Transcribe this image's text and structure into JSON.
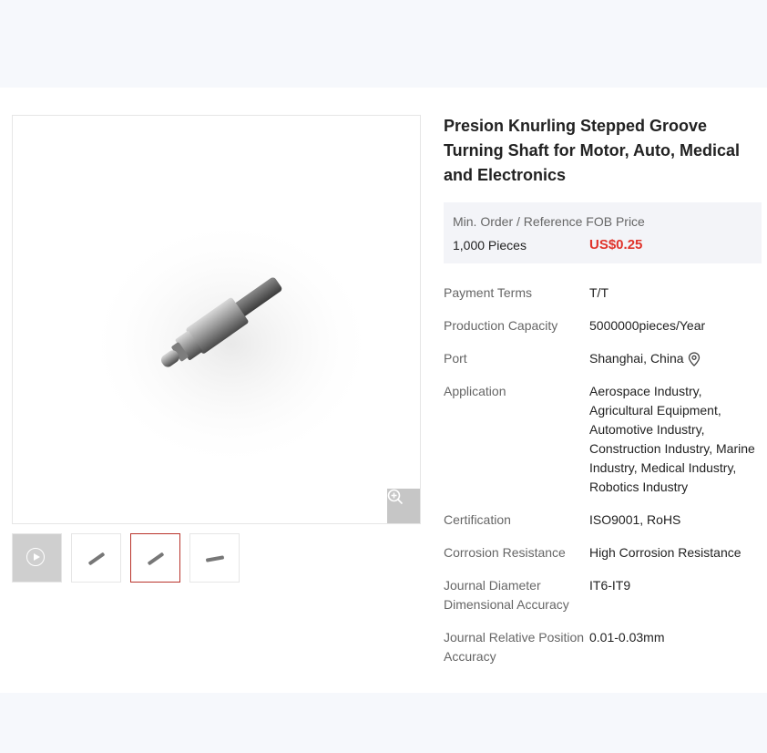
{
  "product": {
    "title": "Presion Knurling Stepped Groove Turning Shaft for Motor, Auto, Medical and Electronics",
    "price_box": {
      "label": "Min. Order / Reference FOB Price",
      "moq": "1,000 Pieces",
      "price": "US$0.25"
    },
    "specs": [
      {
        "key": "Payment Terms",
        "value": "T/T"
      },
      {
        "key": "Production Capacity",
        "value": "5000000pieces/Year"
      },
      {
        "key": "Port",
        "value": "Shanghai, China"
      },
      {
        "key": "Application",
        "value": "Aerospace Industry, Agricultural Equipment, Automotive Industry, Construction Industry, Marine Industry, Medical Industry, Robotics Industry"
      },
      {
        "key": "Certification",
        "value": "ISO9001, RoHS"
      },
      {
        "key": "Corrosion Resistance",
        "value": "High Corrosion Resistance"
      },
      {
        "key": "Journal Diameter Dimensional Accuracy",
        "value": "IT6-IT9"
      },
      {
        "key": "Journal Relative Position Accuracy",
        "value": "0.01-0.03mm"
      }
    ]
  },
  "gallery": {
    "icons": {
      "zoom": "zoom-in-icon",
      "play": "play-icon",
      "port": "location-pin-icon"
    },
    "thumbnails": [
      "video",
      "image",
      "image",
      "image"
    ],
    "selected_thumbnail": 2
  },
  "colors": {
    "price": "#e0332b",
    "active_border": "#b9332b",
    "price_bg": "#f3f4f8"
  }
}
